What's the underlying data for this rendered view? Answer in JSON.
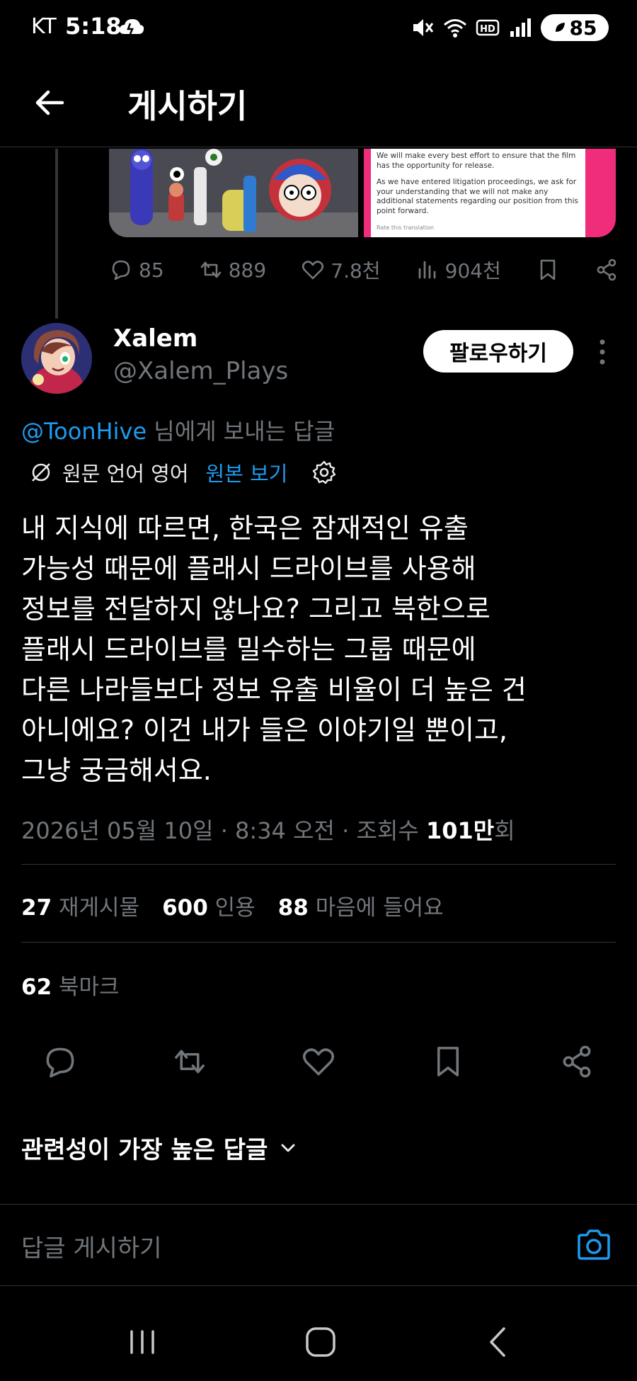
{
  "status_bar": {
    "carrier": "KT",
    "time": "5:18",
    "battery": "85"
  },
  "header": {
    "title": "게시하기"
  },
  "quoted_media": {
    "notice_lines": [
      "We will make every best effort to ensure that the film has the opportunity for release.",
      "As we have entered litigation proceedings, we ask for your understanding that we will not make any additional statements regarding our position from this point forward."
    ],
    "notice_footer": "Rate this translation"
  },
  "top_actions": {
    "replies": "85",
    "reposts": "889",
    "likes": "7.8천",
    "views": "904천"
  },
  "author": {
    "name": "Xalem",
    "handle": "@Xalem_Plays",
    "follow_label": "팔로우하기"
  },
  "reply_to": {
    "mention": "@ToonHive",
    "suffix": " 님에게 보내는 답글"
  },
  "translation": {
    "source_text": "원문 언어 영어",
    "view_original": "원본 보기"
  },
  "tweet": {
    "text": "내 지식에 따르면, 한국은 잠재적인 유출\n가능성 때문에 플래시 드라이브를 사용해\n정보를 전달하지 않나요? 그리고 북한으로\n플래시 드라이브를 밀수하는 그룹 때문에\n다른 나라들보다 정보 유출 비율이 더 높은 건\n아니에요? 이건 내가 들은 이야기일 뿐이고,\n그냥 궁금해서요."
  },
  "meta": {
    "timestamp": "2026년 05월 10일 · 8:34 오전 · 조회수 ",
    "views_value": "101만",
    "views_suffix": "회"
  },
  "stats": {
    "reposts_count": "27",
    "reposts_label": " 재게시물",
    "quotes_count": "600",
    "quotes_label": " 인용",
    "likes_count": "88",
    "likes_label": " 마음에 들어요",
    "bookmarks_count": "62",
    "bookmarks_label": " 북마크"
  },
  "sort": {
    "label": "관련성이 가장 높은 답글"
  },
  "reply_bar": {
    "placeholder": "답글 게시하기"
  },
  "colors": {
    "accent": "#1d9bf0",
    "background": "#000000",
    "muted": "#71767b",
    "divider": "#2f3336"
  },
  "icons": [
    "back-arrow-icon",
    "reply-icon",
    "repost-icon",
    "like-icon",
    "views-icon",
    "bookmark-icon",
    "share-icon",
    "more-icon",
    "translate-icon",
    "gear-icon",
    "chevron-down-icon",
    "camera-icon",
    "recent-apps-icon",
    "home-icon",
    "nav-back-icon"
  ]
}
